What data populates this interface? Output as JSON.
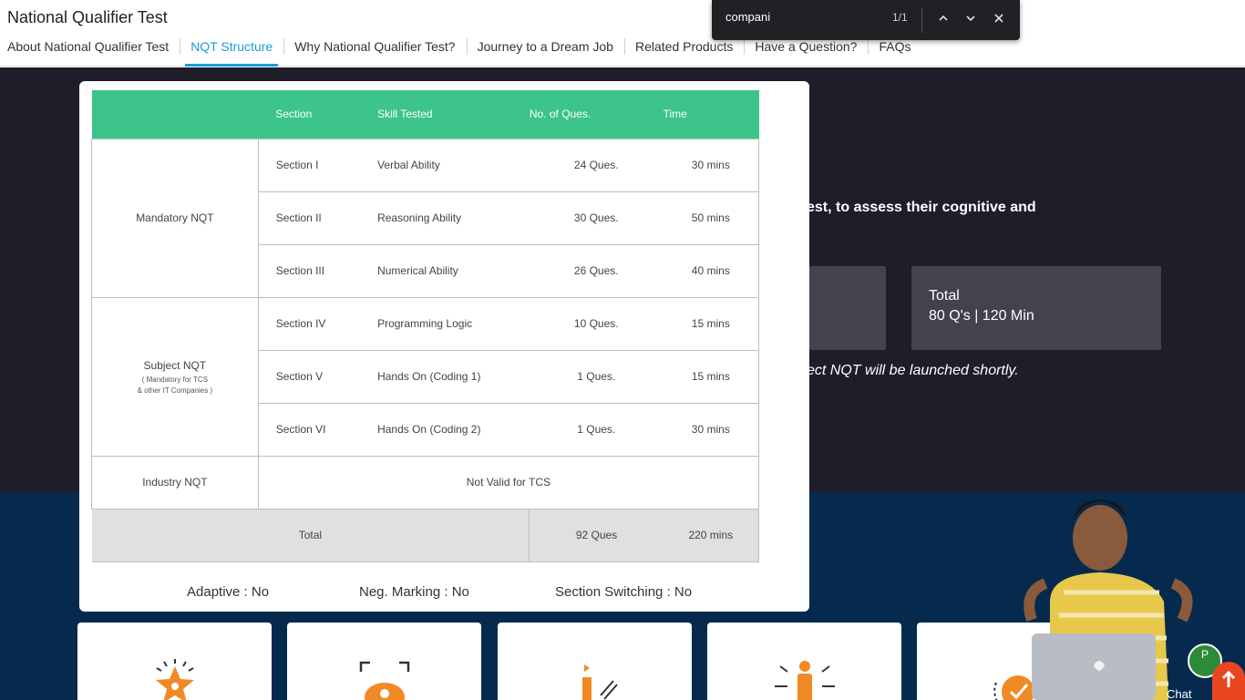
{
  "header": {
    "site_title": "National Qualifier Test",
    "nav": [
      {
        "label": "About National Qualifier Test",
        "active": false
      },
      {
        "label": "NQT Structure",
        "active": true
      },
      {
        "label": "Why National Qualifier Test?",
        "active": false
      },
      {
        "label": "Journey to a Dream Job",
        "active": false
      },
      {
        "label": "Related Products",
        "active": false
      },
      {
        "label": "Have a Question?",
        "active": false
      },
      {
        "label": "FAQs",
        "active": false
      }
    ]
  },
  "find_bar": {
    "query": "compani",
    "count": "1/1"
  },
  "background": {
    "text_fragment_1": "est, to assess their cognitive and",
    "total_label": "Total",
    "total_value": "80 Q's | 120 Min",
    "text_fragment_2": "ect NQT will be launched shortly."
  },
  "table": {
    "headers": {
      "section": "Section",
      "skill": "Skill Tested",
      "questions": "No. of Ques.",
      "time": "Time"
    },
    "groups": {
      "mandatory": "Mandatory NQT",
      "subject": "Subject NQT",
      "subject_note_1": "( Mandatory for TCS",
      "subject_note_2": "& other IT Companies )",
      "industry": "Industry NQT",
      "industry_value": "Not Valid for TCS"
    },
    "rows": [
      {
        "section": "Section I",
        "skill": "Verbal Ability",
        "questions": "24 Ques.",
        "time": "30 mins"
      },
      {
        "section": "Section II",
        "skill": "Reasoning Ability",
        "questions": "30 Ques.",
        "time": "50 mins"
      },
      {
        "section": "Section III",
        "skill": "Numerical Ability",
        "questions": "26 Ques.",
        "time": "40 mins"
      },
      {
        "section": "Section IV",
        "skill": "Programming Logic",
        "questions": "10 Ques.",
        "time": "15 mins"
      },
      {
        "section": "Section V",
        "skill": "Hands On (Coding 1)",
        "questions": "1 Ques.",
        "time": "15 mins"
      },
      {
        "section": "Section VI",
        "skill": "Hands On (Coding 2)",
        "questions": "1 Ques.",
        "time": "30 mins"
      }
    ],
    "total": {
      "label": "Total",
      "questions": "92 Ques",
      "time": "220 mins"
    }
  },
  "meta": {
    "adaptive": "Adaptive : No",
    "neg_marking": "Neg. Marking : No",
    "section_switching": "Section Switching : No"
  },
  "chat": {
    "badge": "P",
    "label": "Chat"
  },
  "colors": {
    "accent": "#1a9cd8",
    "table_header": "#3cc48a",
    "dark_band": "#1e1e2b",
    "blue_band": "#062a4e",
    "orange": "#f08a24"
  }
}
